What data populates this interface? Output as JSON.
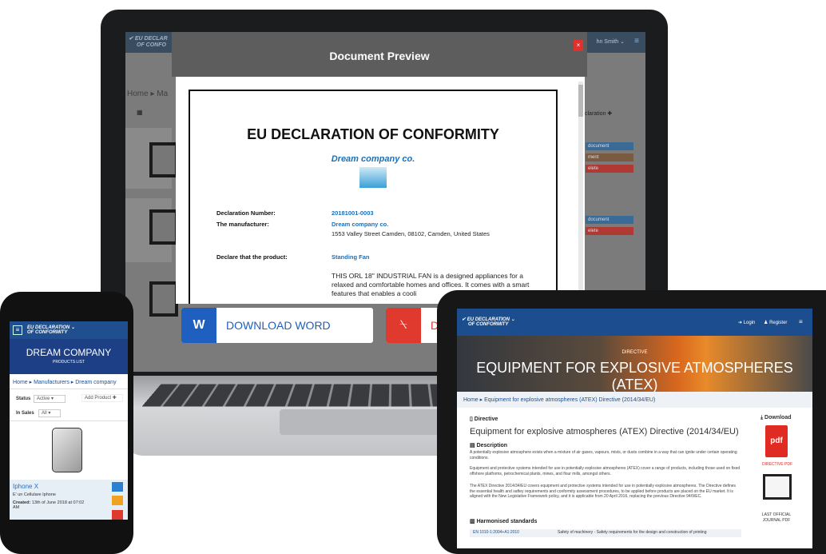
{
  "laptop": {
    "nav": {
      "logo_line1": "EU DECLAR",
      "logo_line2": "OF CONFO",
      "user": "hn Smith ⌄",
      "menu_icon": "≡"
    },
    "background": {
      "breadcrumb": "Home ▸ Ma",
      "add_declaration": "claration ✚",
      "btn_doc": "document",
      "btn_ment": "ment",
      "btn_delete": "elete",
      "btn_doc2": "document",
      "btn_delete2": "elete"
    },
    "modal": {
      "title": "Document Preview",
      "close": "×",
      "doc_title": "EU DECLARATION OF CONFORMITY",
      "company": "Dream company co.",
      "declaration_number_label": "Declaration Number:",
      "declaration_number": "20181001-0003",
      "manufacturer_label": "The manufacturer:",
      "manufacturer_name": "Dream company co.",
      "manufacturer_address": "1553 Valley Street Camden, 08102, Camden, United States",
      "product_label": "Declare that the product:",
      "product_name": "Standing Fan",
      "product_description": "THIS ORL 18\" INDUSTRIAL FAN is a designed appliances for a relaxed and comfortable homes and offices. It comes with a smart features that enables a cooli"
    },
    "downloads": {
      "word": "DOWNLOAD WORD",
      "word_icon": "W",
      "pdf": "DO",
      "pdf_icon": "⍀"
    }
  },
  "phone": {
    "logo_line1": "EU DECLARATION",
    "logo_line2": "OF CONFORMITY",
    "brand": "DREAM COMPANY",
    "brand_sub": "PRODUCTS LIST",
    "breadcrumb": "Home ▸ Manufacturers ▸ Dream company",
    "status_label": "Status",
    "status_value": "Active",
    "add_product": "Add Product ✚",
    "insales_label": "In Sales",
    "insales_value": "All",
    "product_name": "Iphone X",
    "product_desc": "E' un Cellulare Iphone",
    "created_label": "Created:",
    "created_value": "13th of June 2018 at 07:02 AM"
  },
  "tablet": {
    "logo_line1": "EU DECLARATION",
    "logo_line2": "OF CONFORMITY",
    "login": "Login",
    "register": "Register",
    "menu_icon": "≡",
    "hero_sub": "DIRECTIVE",
    "hero_title": "EQUIPMENT FOR EXPLOSIVE ATMOSPHERES (ATEX)",
    "breadcrumb": "Home ▸ Equipment for explosive atmospheres (ATEX) Directive (2014/34/EU)",
    "directive_heading": "Directive",
    "directive_title": "Equipment for explosive atmospheres (ATEX) Directive (2014/34/EU)",
    "description_heading": "Description",
    "para1": "A potentially explosive atmosphere exists when a mixture of air gases, vapours, mists, or dusts combine in a way that can ignite under certain operating conditions.",
    "para2": "Equipment and protective systems intended for use in potentially explosive atmospheres (ATEX) cover a range of products, including those used on fixed offshore platforms, petrochemical plants, mines, and flour mills, amongst others.",
    "para3": "The ATEX Directive 2014/34/EU covers equipment and protective systems intended for use in potentially explosive atmospheres. The Directive defines the essential health and saftey requirements and conformity assessment procedures, to be applied before products are placed on the EU market. It is aligned with the New Legislative Framework policy, and it is applicable from 20 April 2016, replacing the previous Directive 94/9/EC.",
    "standards_heading": "Harmonised standards",
    "standard_code": "EN 1010-1:2004+A1:2010",
    "standard_desc": "Safety of machinery - Safety requirements for the design and construction of printing",
    "download_heading": "Download",
    "pdf_icon_text": "pdf",
    "directive_pdf": "DIRECTIVE PDF",
    "journal_label": "LAST OFFICIAL JOURNAL PDF"
  }
}
